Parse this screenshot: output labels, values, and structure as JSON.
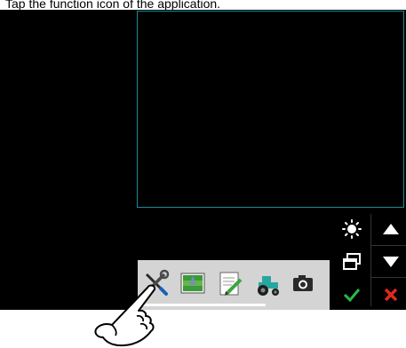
{
  "instruction": {
    "text": "Tap the function icon of the application."
  },
  "side_buttons": {
    "brightness": "sun-icon",
    "scroll_up": "triangle-up-icon",
    "window_switch": "windows-icon",
    "scroll_down": "triangle-down-icon",
    "confirm": "checkmark-icon",
    "cancel": "cross-icon"
  },
  "taskbar": {
    "apps": [
      "wrench-screwdriver-icon",
      "field-map-icon",
      "notepad-pencil-icon",
      "tractor-icon",
      "camera-icon"
    ]
  },
  "colors": {
    "screen_bg": "#000000",
    "viewport_border": "#1b8a9a",
    "taskbar_bg": "#d4d4d4",
    "confirm_green": "#2db84a",
    "cancel_red": "#e0281e"
  }
}
